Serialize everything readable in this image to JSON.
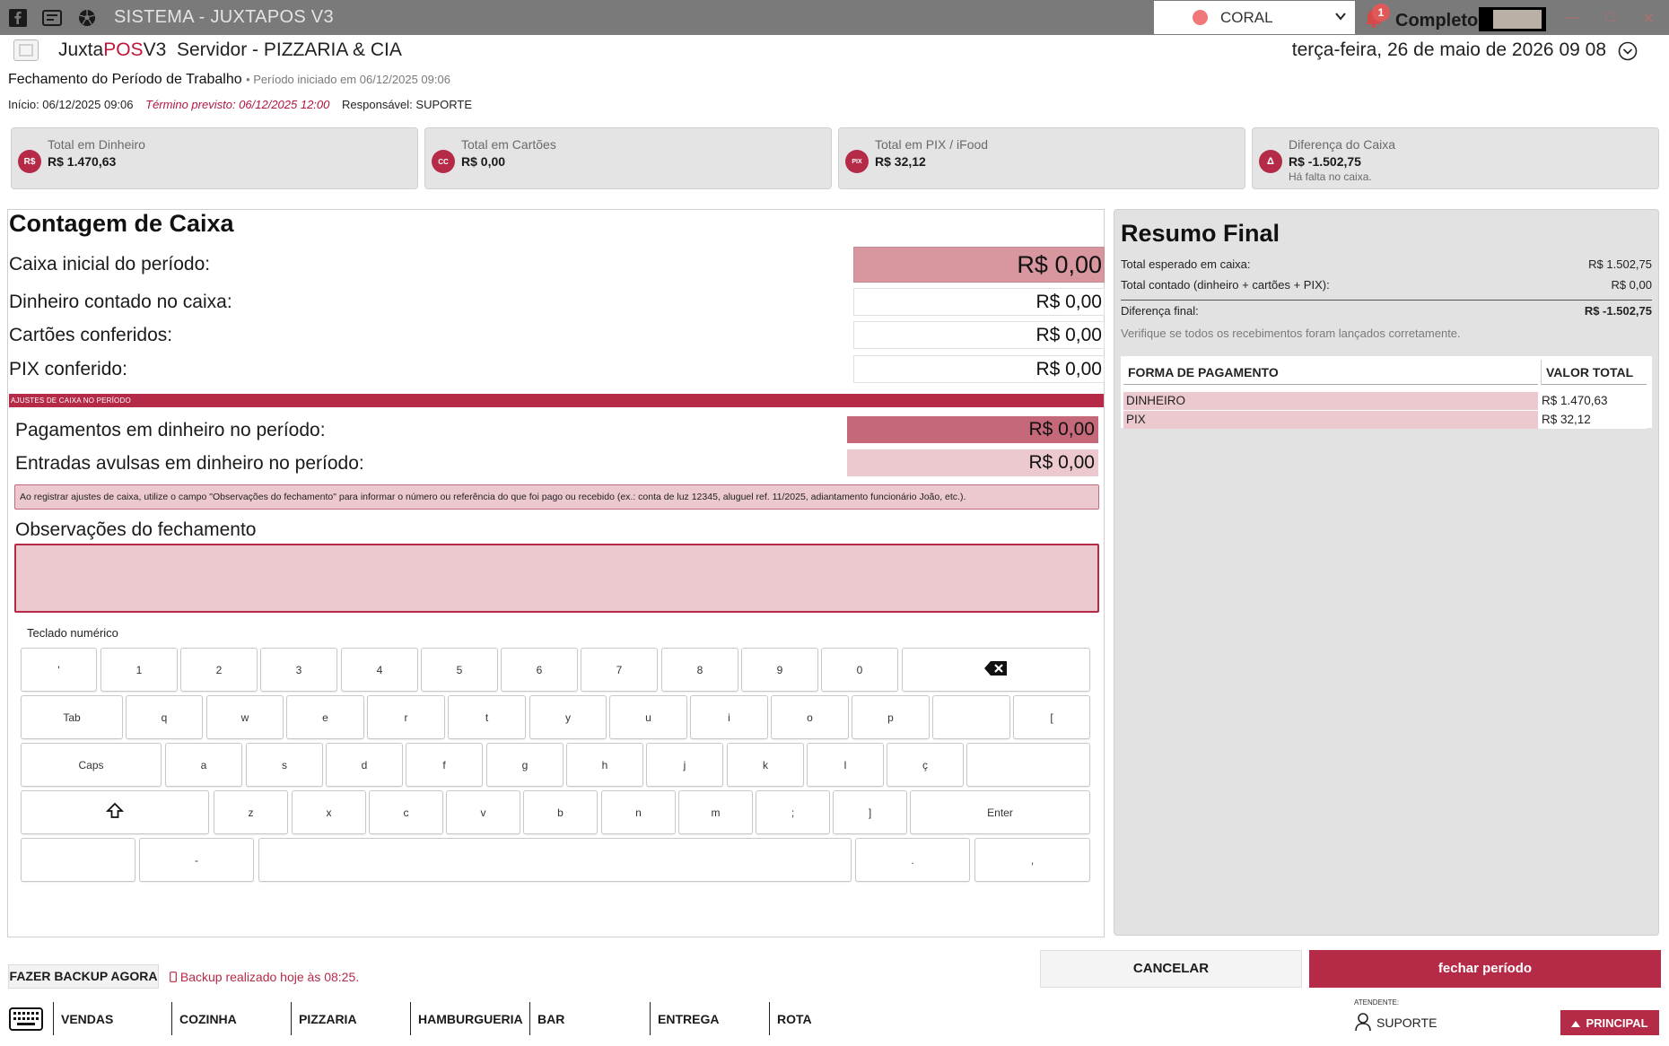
{
  "titlebar": {
    "title": "SISTEMA - JUXTAPOS V3",
    "status_select": {
      "value": "CORAL",
      "dot_color": "#f07878"
    },
    "notifications_count": "1",
    "user": "Completo",
    "icons": [
      "facebook-icon",
      "chat-icon",
      "soccer-ball-icon",
      "chevron-down-icon",
      "bell-icon",
      "minimize-icon",
      "maximize-icon",
      "close-icon"
    ]
  },
  "header": {
    "brand_prefix": "Juxta",
    "brand_pos": "POS",
    "brand_suffix": "V3",
    "server": "Servidor - PIZZARIA & CIA",
    "datetime": "terça-feira, 26 de maio de 2026 09 08",
    "page_title": "Fechamento do Período de Trabalho",
    "page_subtitle": "• Período iniciado em 06/12/2025 09:06",
    "inicio": "Início: 06/12/2025 09:06",
    "termino": "Término previsto: 06/12/2025 12:00",
    "responsavel": "Responsável: SUPORTE"
  },
  "cards": [
    {
      "icon": "R$",
      "label": "Total em Dinheiro",
      "value": "R$ 1.470,63",
      "note": ""
    },
    {
      "icon": "CC",
      "label": "Total em Cartões",
      "value": "R$ 0,00",
      "note": ""
    },
    {
      "icon": "PIX",
      "label": "Total em PIX / iFood",
      "value": "R$ 32,12",
      "note": ""
    },
    {
      "icon": "Δ",
      "label": "Diferença do Caixa",
      "value": "R$ -1.502,75",
      "note": "Há falta no caixa."
    }
  ],
  "contagem": {
    "title": "Contagem de Caixa",
    "rows": [
      {
        "label": "Caixa inicial do período:",
        "value": "R$ 0,00"
      },
      {
        "label": "Dinheiro contado no caixa:",
        "value": "R$ 0,00"
      },
      {
        "label": "Cartões conferidos:",
        "value": "R$ 0,00"
      },
      {
        "label": "PIX conferido:",
        "value": "R$ 0,00"
      }
    ],
    "ajustes_bar": "AJUSTES DE CAIXA NO PERÍODO",
    "ajustes": [
      {
        "label": "Pagamentos em dinheiro no período:",
        "value": "R$ 0,00"
      },
      {
        "label": "Entradas avulsas em dinheiro no período:",
        "value": "R$ 0,00"
      }
    ],
    "ajustes_note": "Ao registrar ajustes de caixa, utilize o campo \"Observações do fechamento\" para informar o número ou referência do que foi pago ou recebido (ex.: conta de luz 12345, aluguel ref. 11/2025, adiantamento funcionário João, etc.).",
    "obs_label": "Observações do fechamento",
    "obs_value": "",
    "keyboard_label": "Teclado numérico"
  },
  "keyboard": {
    "row1": [
      "'",
      "1",
      "2",
      "3",
      "4",
      "5",
      "6",
      "7",
      "8",
      "9",
      "0"
    ],
    "row2": [
      "Tab",
      "q",
      "w",
      "e",
      "r",
      "t",
      "y",
      "u",
      "i",
      "o",
      "p",
      "",
      "["
    ],
    "row3": [
      "Caps",
      "a",
      "s",
      "d",
      "f",
      "g",
      "h",
      "j",
      "k",
      "l",
      "ç",
      ""
    ],
    "row4": [
      "z",
      "x",
      "c",
      "v",
      "b",
      "n",
      "m",
      ";",
      "]",
      "Enter"
    ],
    "row5": [
      "",
      "-",
      "",
      ".",
      ","
    ]
  },
  "resumo": {
    "title": "Resumo Final",
    "esperado_label": "Total esperado em caixa:",
    "esperado_value": "R$ 1.502,75",
    "contado_label": "Total contado (dinheiro + cartões + PIX):",
    "contado_value": "R$ 0,00",
    "diferenca_label": "Diferença final:",
    "diferenca_value": "R$ -1.502,75",
    "hint": "Verifique se todos os recebimentos foram lançados corretamente.",
    "table": {
      "headers": [
        "FORMA DE PAGAMENTO",
        "VALOR TOTAL"
      ],
      "rows": [
        {
          "forma": "DINHEIRO",
          "valor": "R$ 1.470,63"
        },
        {
          "forma": "PIX",
          "valor": "R$ 32,12"
        }
      ]
    }
  },
  "actions": {
    "backup_label": "FAZER BACKUP AGORA",
    "backup_status": "Backup realizado hoje às 08:25.",
    "cancel_label": "CANCELAR",
    "close_label": "fechar período"
  },
  "bottom_nav": {
    "items": [
      "VENDAS",
      "COZINHA",
      "PIZZARIA",
      "HAMBURGUERIA",
      "BAR",
      "ENTREGA",
      "ROTA"
    ],
    "attendant_label": "ATENDENTE:",
    "attendant_name": "SUPORTE",
    "principal_label": "PRINCIPAL"
  },
  "colors": {
    "accent": "#b52a47",
    "pink_light": "#ecc8cf",
    "pink_mid": "#d8969f",
    "titlebar": "#7a7a7a"
  }
}
